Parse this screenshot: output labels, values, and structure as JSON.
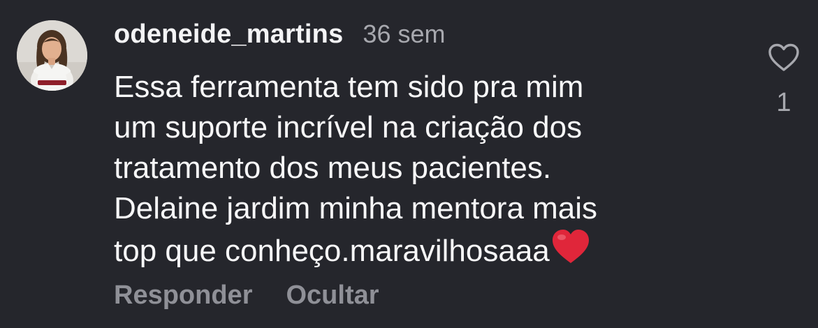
{
  "comment": {
    "username": "odeneide_martins",
    "timestamp": "36 sem",
    "text_lines": [
      "Essa ferramenta tem sido pra mim",
      "um suporte incrível na criação dos",
      "tratamento dos meus pacientes.",
      "Delaine jardim minha mentora mais",
      "top que conheço.maravilhosaaa"
    ],
    "emoji": "red-heart-emoji",
    "avatar_icon": "profile-photo-avatar",
    "like_icon": "heart-outline-icon",
    "like_count": "1"
  },
  "actions": {
    "reply_label": "Responder",
    "hide_label": "Ocultar"
  },
  "colors": {
    "background": "#25262c",
    "text": "#f7f7f8",
    "muted": "#a7a8ae",
    "action": "#8f9097",
    "heart_emoji": "#e0263a"
  }
}
